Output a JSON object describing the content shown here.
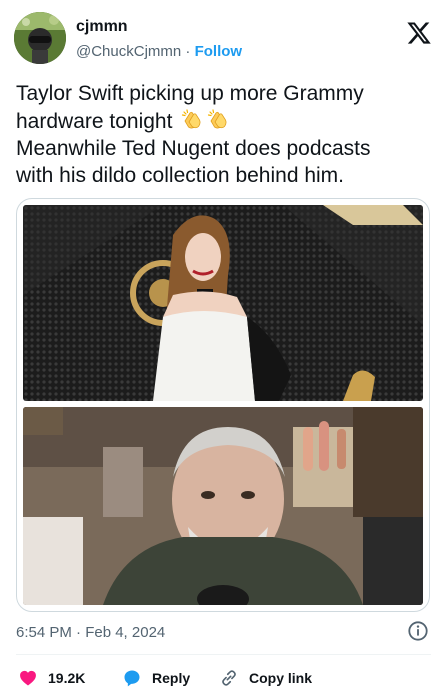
{
  "author": {
    "name": "cjmmn",
    "handle": "@ChuckCjmmn",
    "separator": "·",
    "follow_label": "Follow"
  },
  "tweet": {
    "line1": "Taylor Swift picking up more Grammy",
    "line2": "hardware tonight",
    "line3": "Meanwhile Ted Nugent does podcasts",
    "line4": "with his dildo collection behind him."
  },
  "meta": {
    "timestamp": "6:54 PM · Feb 4, 2024"
  },
  "actions": {
    "like_count": "19.2K",
    "reply_label": "Reply",
    "copy_label": "Copy link"
  },
  "colors": {
    "accent": "#1d9bf0",
    "like": "#f91880",
    "text": "#0f1419",
    "muted": "#536471"
  },
  "icons": [
    "x-logo-icon",
    "clapping-hands-icon",
    "info-icon",
    "heart-icon",
    "reply-bubble-icon",
    "link-icon"
  ]
}
